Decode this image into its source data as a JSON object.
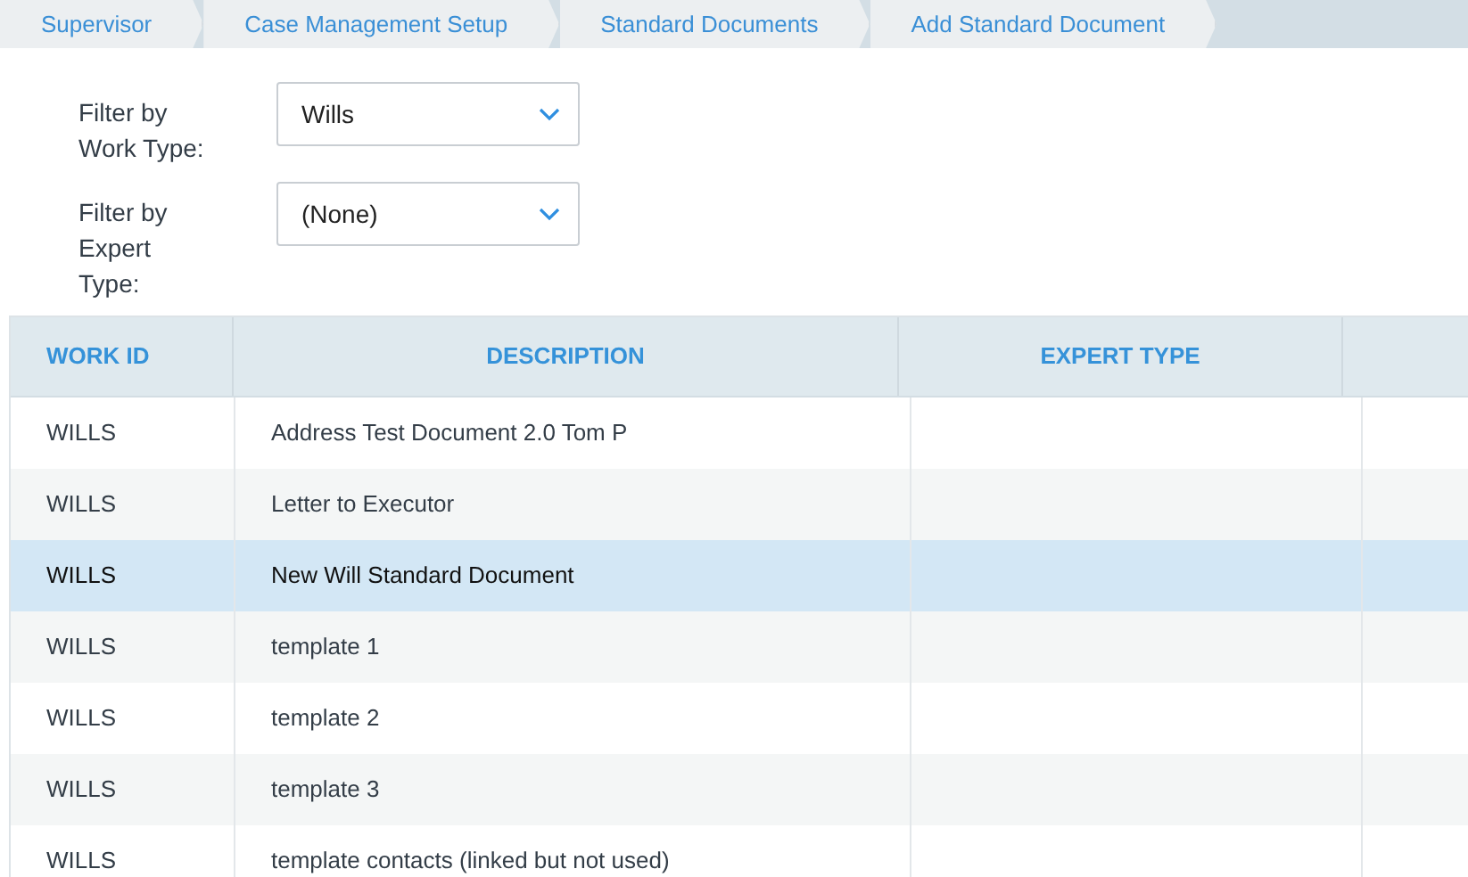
{
  "breadcrumb": [
    {
      "label": "Supervisor"
    },
    {
      "label": "Case Management Setup"
    },
    {
      "label": "Standard Documents"
    },
    {
      "label": "Add Standard Document"
    }
  ],
  "filters": [
    {
      "label": "Filter by Work Type:",
      "value": "Wills"
    },
    {
      "label": "Filter by Expert Type:",
      "value": "(None)"
    }
  ],
  "table": {
    "columns": [
      "WORK ID",
      "DESCRIPTION",
      "EXPERT TYPE"
    ],
    "rows": [
      {
        "work_id": "WILLS",
        "description": "Address Test Document 2.0 Tom P",
        "selected": false
      },
      {
        "work_id": "WILLS",
        "description": "Letter to Executor",
        "selected": false
      },
      {
        "work_id": "WILLS",
        "description": "New Will Standard Document",
        "selected": true
      },
      {
        "work_id": "WILLS",
        "description": "template 1",
        "selected": false
      },
      {
        "work_id": "WILLS",
        "description": "template 2",
        "selected": false
      },
      {
        "work_id": "WILLS",
        "description": "template 3",
        "selected": false
      },
      {
        "work_id": "WILLS",
        "description": "template contacts (linked but not used)",
        "selected": false
      }
    ]
  }
}
